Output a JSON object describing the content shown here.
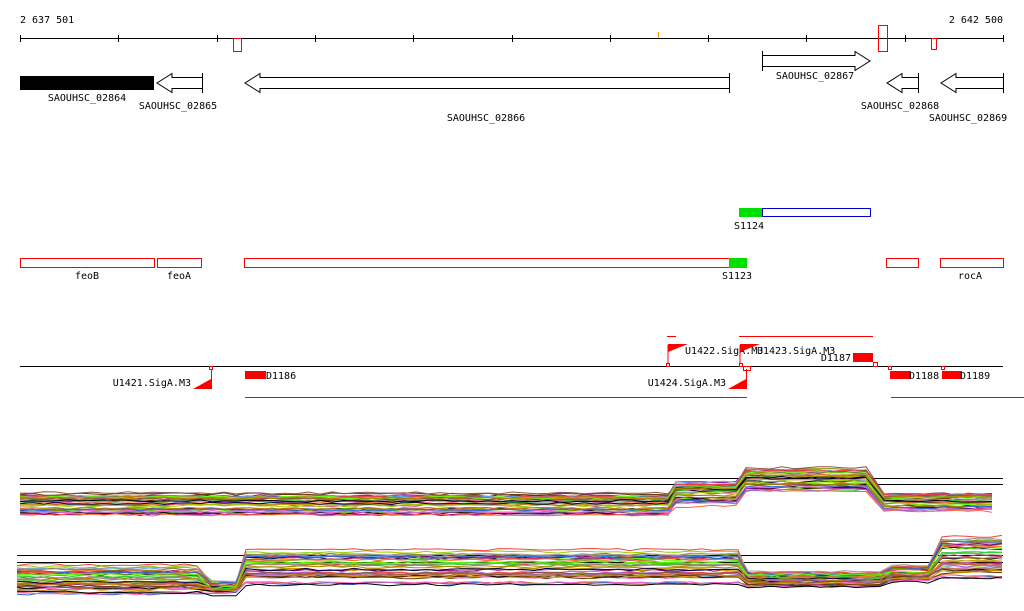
{
  "axis": {
    "start_label": "2 637 501",
    "end_label": "2 642 500"
  },
  "genes": [
    {
      "name": "SAOUHSC_02864",
      "strand": "filled"
    },
    {
      "name": "SAOUHSC_02865",
      "strand": "-"
    },
    {
      "name": "SAOUHSC_02866",
      "strand": "-"
    },
    {
      "name": "SAOUHSC_02867",
      "strand": "+"
    },
    {
      "name": "SAOUHSC_02868",
      "strand": "-"
    },
    {
      "name": "SAOUHSC_02869",
      "strand": "-"
    }
  ],
  "segments_upper": [
    {
      "label": "S1124"
    }
  ],
  "segments_lower": [
    {
      "label": "feoB"
    },
    {
      "label": "feoA"
    },
    {
      "label": ""
    },
    {
      "label": "S1123"
    },
    {
      "label": ""
    },
    {
      "label": "rocA"
    }
  ],
  "features": [
    {
      "label": "U1421.SigA.M3"
    },
    {
      "label": "D1186"
    },
    {
      "label": "U1422.SigA.M3"
    },
    {
      "label": "U1423.SigA.M3"
    },
    {
      "label": "U1424.SigA.M3"
    },
    {
      "label": "D1187"
    },
    {
      "label": "D1188"
    },
    {
      "label": "D1189"
    }
  ],
  "colors": {
    "feature": "#ff0000",
    "gene": "#000000",
    "segment_highlight": "#00e000",
    "segment_box": "#0000cc"
  }
}
